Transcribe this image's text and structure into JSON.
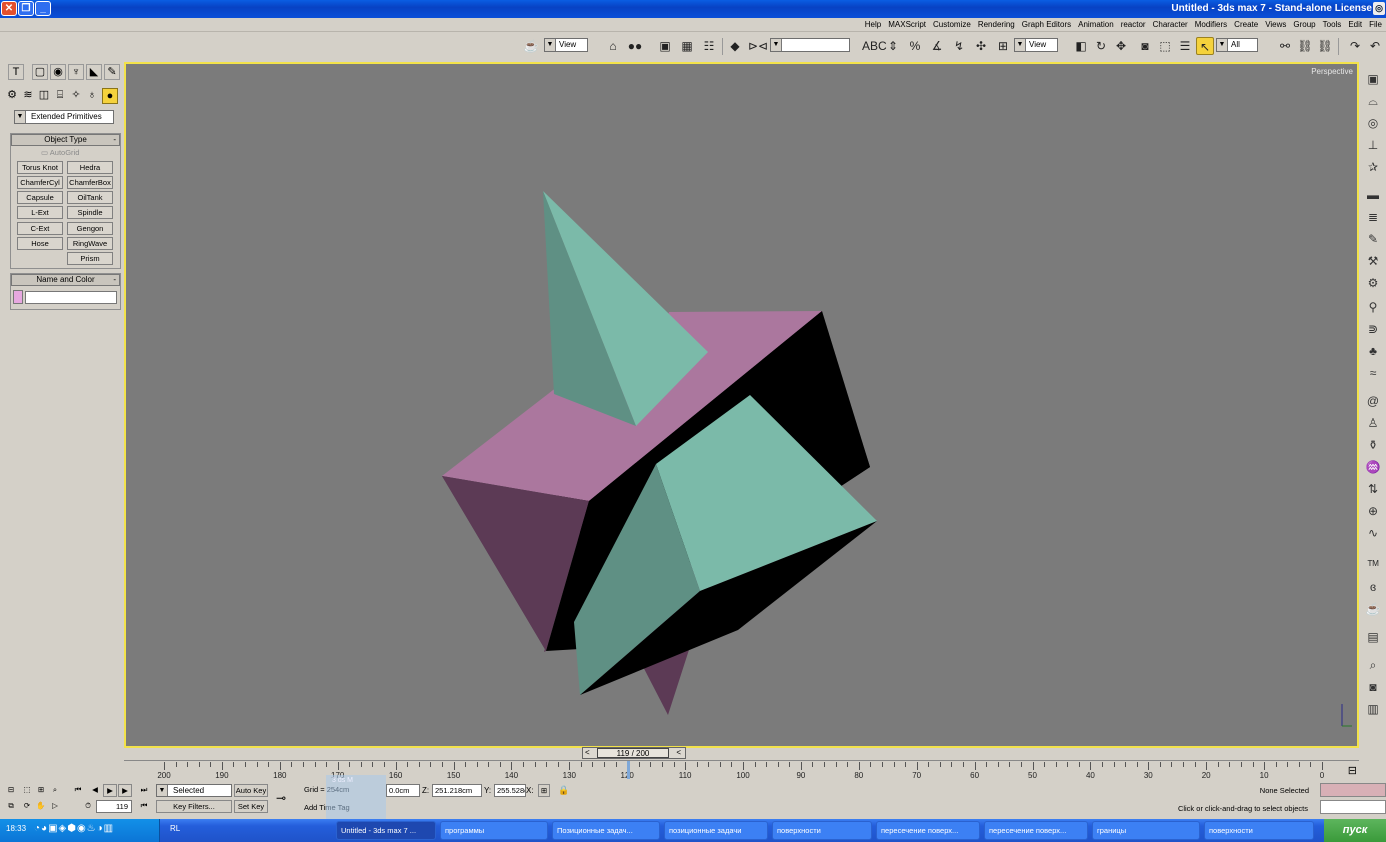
{
  "window": {
    "title": "Untitled - 3ds max 7 - Stand-alone License"
  },
  "menu": [
    "File",
    "Edit",
    "Tools",
    "Group",
    "Views",
    "Create",
    "Modifiers",
    "Character",
    "reactor",
    "Animation",
    "Graph Editors",
    "Rendering",
    "Customize",
    "MAXScript",
    "Help"
  ],
  "toolbar": {
    "selection_filter": "All",
    "ref_coord": "View",
    "render_type": "View",
    "named_sel": ""
  },
  "command_panel": {
    "category": "Extended Primitives",
    "object_type_title": "Object Type",
    "autogrid": "AutoGrid",
    "buttons": [
      "Hedra",
      "Torus Knot",
      "ChamferBox",
      "ChamferCyl",
      "OilTank",
      "Capsule",
      "Spindle",
      "L-Ext",
      "Gengon",
      "C-Ext",
      "RingWave",
      "Hose",
      "Prism"
    ],
    "name_color_title": "Name and Color",
    "object_color": "#e7a8e0",
    "collapse": "-"
  },
  "viewport": {
    "label": "Perspective",
    "bg": "#7b7b7b",
    "border": "#f2e24a"
  },
  "time": {
    "slider_label": "119 / 200",
    "ticks": [
      "0",
      "10",
      "20",
      "30",
      "40",
      "50",
      "60",
      "70",
      "80",
      "90",
      "100",
      "110",
      "120",
      "130",
      "140",
      "150",
      "160",
      "170",
      "180",
      "190",
      "200"
    ]
  },
  "status": {
    "selection": "None Selected",
    "prompt": "Click or click-and-drag to select objects",
    "x_label": "X:",
    "x": "255.528cm",
    "y_label": "Y:",
    "y": "251.218cm",
    "z_label": "Z:",
    "z": "0.0cm",
    "grid": "Grid = 254cm",
    "add_time_tag": "Add Time Tag",
    "auto_key": "Auto Key",
    "set_key": "Set Key",
    "key_mode": "Selected",
    "key_filters": "Key Filters...",
    "frame": "119",
    "max_sidebar": "3 ds M"
  },
  "taskbar": {
    "start": "пуск",
    "items": [
      "поверхности",
      "границы",
      "пересечение поверх...",
      "пересечение поверх...",
      "поверхности",
      "позиционные задачи",
      "Позиционные задач...",
      "программы",
      "Untitled - 3ds max 7 ..."
    ],
    "lang": "RL",
    "clock": "18:33"
  }
}
